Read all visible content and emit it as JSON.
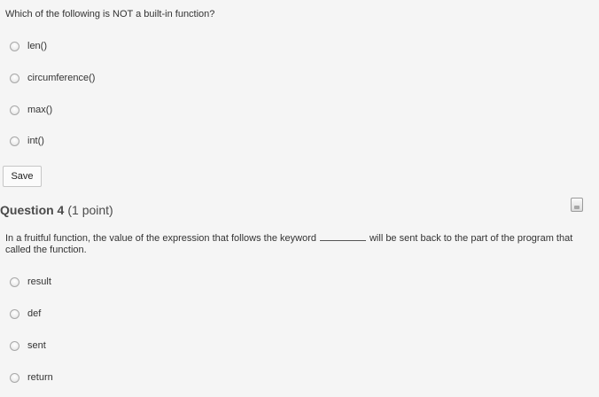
{
  "question3": {
    "prompt": "Which of the following is NOT a built-in function?",
    "options": [
      "len()",
      "circumference()",
      "max()",
      "int()"
    ]
  },
  "save_label": "Save",
  "question4": {
    "label": "Question 4",
    "points": "(1 point)",
    "text_before": "In a fruitful function, the value of the expression that follows the keyword",
    "text_after": "will be sent back to the part of the program that called the function.",
    "options": [
      "result",
      "def",
      "sent",
      "return"
    ]
  },
  "colors": {
    "background": "#f5f5f5",
    "text": "#333333",
    "header": "#4a4a4a"
  },
  "icons": {
    "flag": "bookmark-flag-icon"
  }
}
